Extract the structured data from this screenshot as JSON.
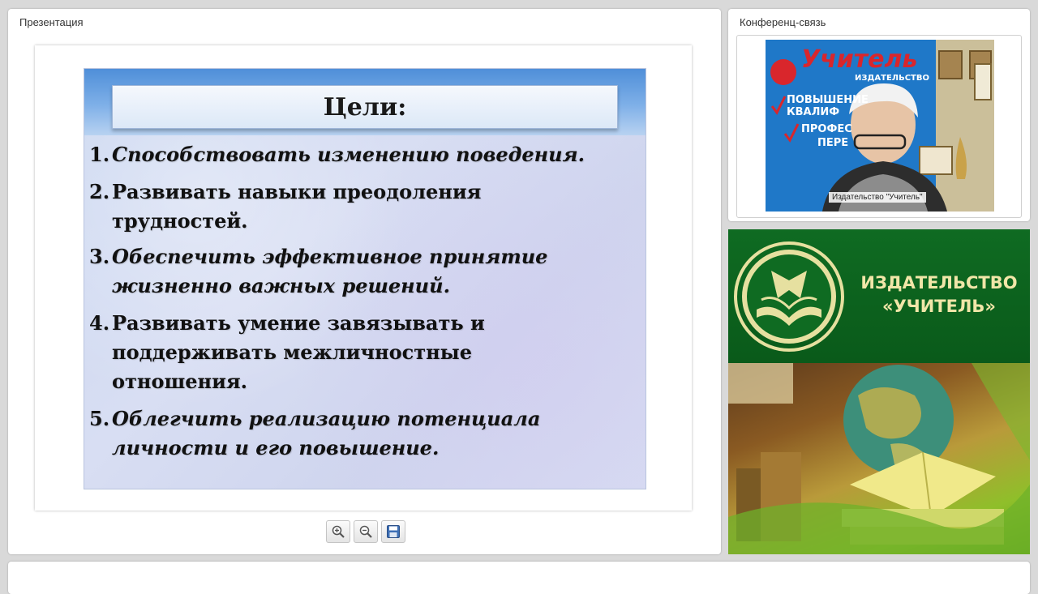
{
  "presentation": {
    "title": "Презентация",
    "slide": {
      "heading": "Цели:",
      "goals": [
        {
          "num": "1.",
          "text": "Способствовать изменению поведения.",
          "italic": true
        },
        {
          "num": "2.",
          "text": "Развивать навыки преодоления трудностей.",
          "italic": false
        },
        {
          "num": "3.",
          "text": "Обеспечить эффективное принятие жизненно важных решений.",
          "italic": true
        },
        {
          "num": "4.",
          "text": "Развивать умение завязывать и поддерживать межличностные отношения.",
          "italic": false
        },
        {
          "num": "5.",
          "text": "Облегчить реализацию потенциала личности и его повышение.",
          "italic": true
        }
      ]
    },
    "toolbar": {
      "zoom_in_icon": "zoom-in-icon",
      "zoom_out_icon": "zoom-out-icon",
      "save_icon": "floppy-disk-icon"
    }
  },
  "conference": {
    "title": "Конференц-связь",
    "video": {
      "caption": "Издательство \"Учитель\"",
      "backdrop_text": "Учитель",
      "backdrop_subtext": "ИЗДАТЕЛЬСТВО",
      "backdrop_lines": [
        "ПОВЫШЕНИЕ",
        "КВАЛИФ",
        "ПРОФЕС",
        "ПЕРЕ"
      ]
    }
  },
  "banner": {
    "name_line1": "ИЗДАТЕЛЬСТВО",
    "name_line2": "«УЧИТЕЛЬ»",
    "colors": {
      "green": "#0f6b22",
      "gold": "#f1e6a8"
    }
  }
}
